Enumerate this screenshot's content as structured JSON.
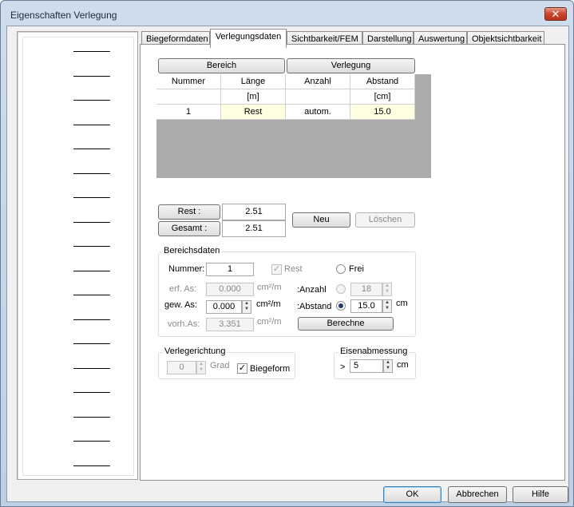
{
  "window": {
    "title": "Eigenschaften Verlegung",
    "close_glyph": "✕"
  },
  "tabs": [
    "Biegeformdaten",
    "Verlegungsdaten",
    "Sichtbarkeit/FEM",
    "Darstellung",
    "Auswertung",
    "Objektsichtbarkeit"
  ],
  "grid": {
    "group_buttons": [
      "Bereich",
      "Verlegung"
    ],
    "headers": [
      "Nummer",
      "Länge",
      "Anzahl",
      "Abstand"
    ],
    "units": [
      "",
      "[m]",
      "",
      "[cm]"
    ],
    "rows": [
      [
        "1",
        "Rest",
        "autom.",
        "15.0"
      ]
    ]
  },
  "summary": {
    "rest_label": "Rest :",
    "rest_value": "2.51",
    "gesamt_label": "Gesamt :",
    "gesamt_value": "2.51"
  },
  "actions": {
    "neu": "Neu",
    "loeschen": "Löschen"
  },
  "bereichsdaten": {
    "title": "Bereichsdaten",
    "nummer_label": "Nummer:",
    "nummer_value": "1",
    "rest_check_label": "Rest",
    "frei_label": "Frei",
    "erf_label": "erf. As:",
    "erf_value": "0.000",
    "erf_unit": "cm²/m",
    "gew_label": "gew. As:",
    "gew_value": "0.000",
    "gew_unit": "cm²/m",
    "vorh_label": "vorh.As:",
    "vorh_value": "3.351",
    "vorh_unit": "cm²/m",
    "anzahl_label": ":Anzahl",
    "anzahl_value": "18",
    "abstand_label": ":Abstand",
    "abstand_value": "15.0",
    "abstand_unit": "cm",
    "berechne": "Berechne"
  },
  "verlegerichtung": {
    "title": "Verlegerichtung",
    "grad_value": "0",
    "grad_unit": "Grad",
    "biegeform_label": "Biegeform"
  },
  "eisenabmessung": {
    "title": "Eisenabmessung",
    "prefix": ">",
    "value": "5",
    "unit": "cm"
  },
  "footer": {
    "ok": "OK",
    "abbrechen": "Abbrechen",
    "hilfe": "Hilfe"
  }
}
